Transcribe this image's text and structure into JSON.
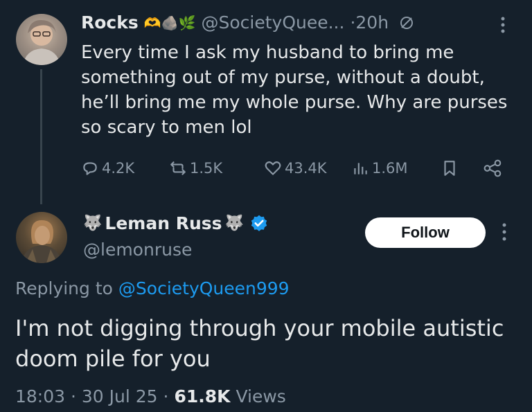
{
  "parent_tweet": {
    "author_name": "Rocks",
    "author_emoji": "🫶🪨🌿",
    "handle": "@SocietyQuee...",
    "time": "·20h",
    "text": "Every time I ask my husband to bring me something out of my purse, without a doubt, he’ll bring me my whole purse. Why are purses so scary to men lol",
    "replies": "4.2K",
    "reposts": "1.5K",
    "likes": "43.4K",
    "views": "1.6M"
  },
  "reply_tweet": {
    "author_name": "Leman Russ",
    "name_emoji_left": "🐺",
    "name_emoji_right": "🐺",
    "handle": "@lemonruse",
    "follow_label": "Follow",
    "replying_prefix": "Replying to",
    "replying_to": "@SocietyQueen999",
    "text": "I'm not digging through your mobile autistic doom pile for you",
    "time": "18:03",
    "date": "30 Jul 25",
    "view_count": "61.8K",
    "views_label": "Views"
  },
  "colors": {
    "background": "#15202b",
    "text": "#e7e9ea",
    "muted": "#8b98a5",
    "accent": "#1d9bf0"
  }
}
